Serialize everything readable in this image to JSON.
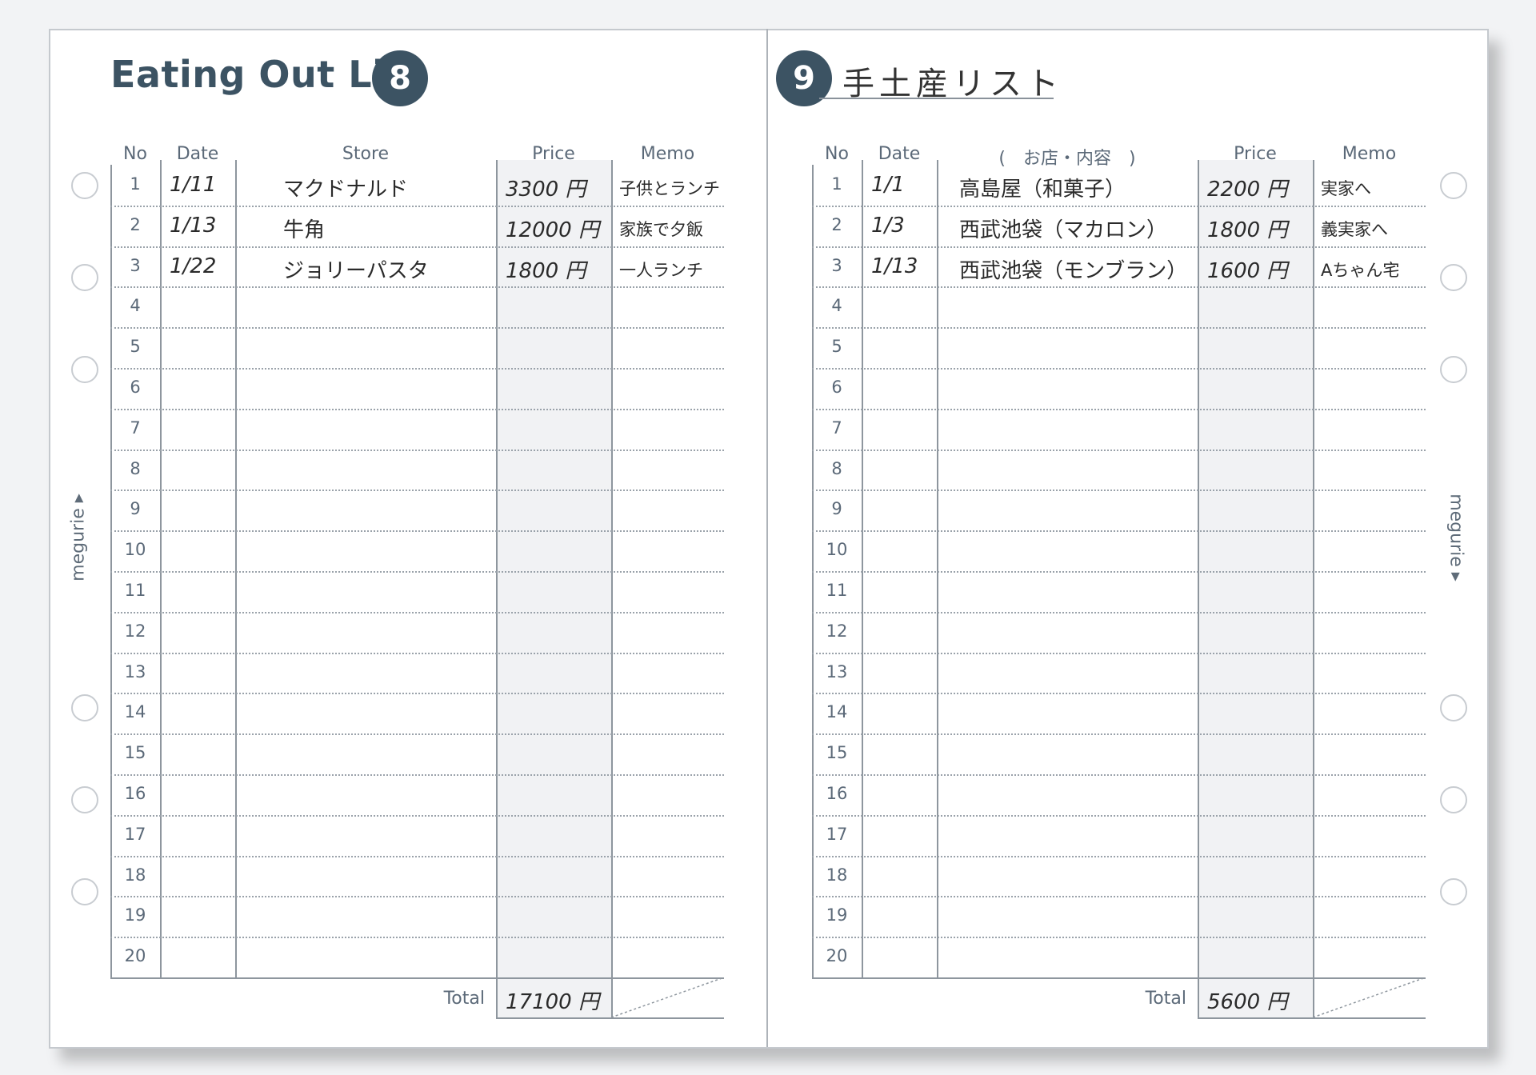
{
  "brand": "megurie",
  "left": {
    "title": "Eating Out List",
    "page_number": "8",
    "headers": {
      "no": "No",
      "date": "Date",
      "store": "Store",
      "price": "Price",
      "memo": "Memo"
    },
    "rows": [
      {
        "date": "1/11",
        "store": "マクドナルド",
        "price": "3300 円",
        "memo": "子供とランチ"
      },
      {
        "date": "1/13",
        "store": "牛角",
        "price": "12000 円",
        "memo": "家族で夕飯"
      },
      {
        "date": "1/22",
        "store": "ジョリーパスタ",
        "price": "1800 円",
        "memo": "一人ランチ"
      }
    ],
    "total_label": "Total",
    "total_value": "17100 円"
  },
  "right": {
    "title": "手土産リスト",
    "page_number": "9",
    "headers": {
      "no": "No",
      "date": "Date",
      "store": "(　お店・内容　)",
      "price": "Price",
      "memo": "Memo"
    },
    "rows": [
      {
        "date": "1/1",
        "store": "高島屋（和菓子）",
        "price": "2200 円",
        "memo": "実家へ"
      },
      {
        "date": "1/3",
        "store": "西武池袋（マカロン）",
        "price": "1800 円",
        "memo": "義実家へ"
      },
      {
        "date": "1/13",
        "store": "西武池袋（モンブラン）",
        "price": "1600 円",
        "memo": "Aちゃん宅"
      }
    ],
    "total_label": "Total",
    "total_value": "5600 円"
  },
  "row_numbers": [
    "1",
    "2",
    "3",
    "4",
    "5",
    "6",
    "7",
    "8",
    "9",
    "10",
    "11",
    "12",
    "13",
    "14",
    "15",
    "16",
    "17",
    "18",
    "19",
    "20"
  ]
}
